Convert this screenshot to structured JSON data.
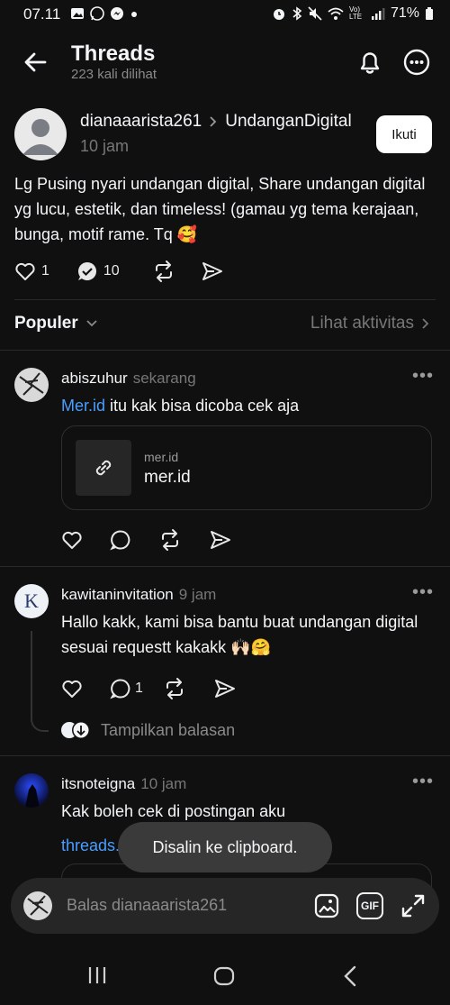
{
  "status": {
    "time": "07.11",
    "battery": "71%",
    "left_icons": [
      "gallery-icon",
      "whatsapp-icon",
      "messenger-icon",
      "dot-icon"
    ],
    "right_icons": [
      "alarm-icon",
      "bluetooth-icon",
      "mute-icon",
      "wifi-icon",
      "volte-icon",
      "signal-icon",
      "battery-icon"
    ],
    "volte_label": "Vo) LTE"
  },
  "header": {
    "title": "Threads",
    "subtitle": "223 kali dilihat"
  },
  "post": {
    "author": "dianaaarista261",
    "community": "UndanganDigital",
    "time": "10 jam",
    "follow_label": "Ikuti",
    "text": "Lg Pusing nyari undangan digital, Share undangan digital yg lucu, estetik, dan timeless! (gamau yg tema kerajaan, bunga, motif rame. Tq 🥰",
    "likes": "1",
    "replies": "10"
  },
  "sort": {
    "label": "Populer",
    "activity_label": "Lihat aktivitas"
  },
  "comments": [
    {
      "name": "abiszuhur",
      "time": "sekarang",
      "link": "Mer.id",
      "text": " itu kak bisa dicoba cek aja",
      "card_domain": "mer.id",
      "card_title": "mer.id"
    },
    {
      "name": "kawitaninvitation",
      "time": "9 jam",
      "text": "Hallo kakk, kami bisa bantu buat undangan digital sesuai requestt kakakk 🙌🏻🤗",
      "replies": "1",
      "show_replies": "Tampilkan balasan",
      "avatar_letter": "K"
    },
    {
      "name": "itsnoteigna",
      "time": "10 jam",
      "text": "Kak boleh cek di postingan aku",
      "link_partial": "threads.com"
    }
  ],
  "toast": "Disalin ke clipboard.",
  "reply": {
    "placeholder": "Balas dianaaarista261",
    "gif_label": "GIF"
  },
  "colors": {
    "background": "#101010",
    "link": "#4a9eff",
    "muted": "#777777"
  }
}
